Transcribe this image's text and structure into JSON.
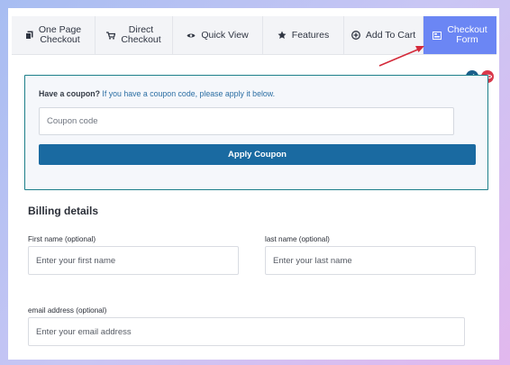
{
  "tabs": [
    {
      "label": "One Page\nCheckout",
      "icon": "copy-icon",
      "active": false
    },
    {
      "label": "Direct\nCheckout",
      "icon": "cart-icon",
      "active": false
    },
    {
      "label": "Quick View",
      "icon": "eye-icon",
      "active": false
    },
    {
      "label": "Features",
      "icon": "star-icon",
      "active": false
    },
    {
      "label": "Add To Cart",
      "icon": "plus-circle-icon",
      "active": false
    },
    {
      "label": "Checkout\nForm",
      "icon": "form-icon",
      "active": true
    }
  ],
  "coupon": {
    "question": "Have a coupon?",
    "hint": "If you have a coupon code, please apply it below.",
    "placeholder": "Coupon code",
    "button_label": "Apply Coupon"
  },
  "billing": {
    "title": "Billing details",
    "first_name_label": "First name (optional)",
    "first_name_placeholder": "Enter your first name",
    "last_name_label": "last name (optional)",
    "last_name_placeholder": "Enter your last name",
    "email_label": "email address (optional)",
    "email_placeholder": "Enter your email address"
  },
  "colors": {
    "active_tab": "#6b86f4",
    "apply_button": "#1a6aa1",
    "coupon_border": "#1d7f8a",
    "edit_circle": "#1a5f8a",
    "view_circle": "#d9394b",
    "arrow": "#d42a3a"
  }
}
